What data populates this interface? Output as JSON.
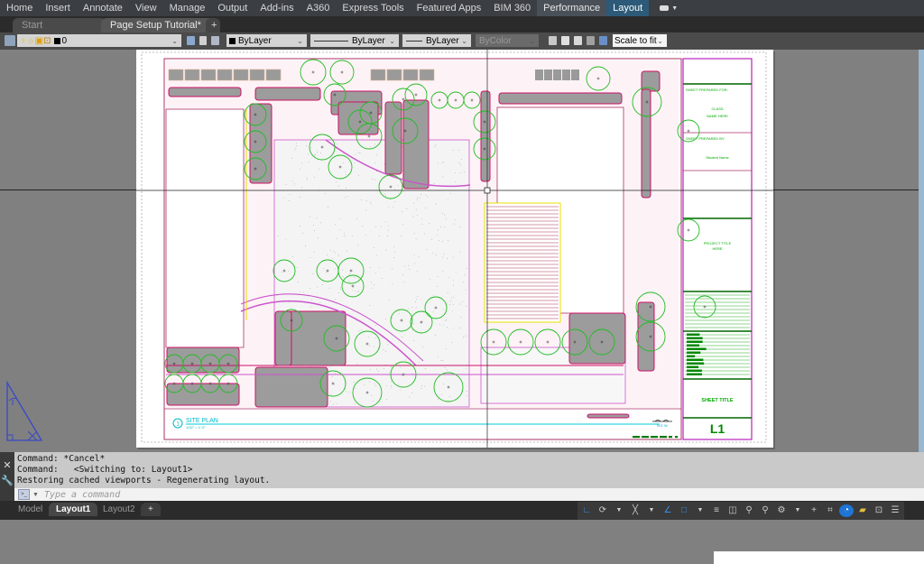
{
  "ribbon": {
    "tabs": [
      "Home",
      "Insert",
      "Annotate",
      "View",
      "Manage",
      "Output",
      "Add-ins",
      "A360",
      "Express Tools",
      "Featured Apps",
      "BIM 360",
      "Performance",
      "Layout"
    ],
    "active_tab": "Layout"
  },
  "doc_tabs": {
    "start": "Start",
    "active": "Page Setup Tutorial*",
    "close": "✕",
    "new": "+"
  },
  "properties": {
    "layer": "0",
    "color": "ByLayer",
    "linetype": "ByLayer",
    "lineweight": "ByLayer",
    "plotstyle": "ByColor",
    "viewport_scale": "Scale to fit"
  },
  "drawing": {
    "view_title": "SITE PLAN",
    "view_number": "1",
    "view_scale": "1/32\" = 1'-0\"",
    "title_block": {
      "prepared_for_label": "SHEET PREPARED FOR:",
      "prepared_for_value_1": "CLASS",
      "prepared_for_value_2": "NAME HERE",
      "prepared_by_label": "SHEET PREPARED BY:",
      "prepared_by_value": "Student Name",
      "project_title_1": "PROJECT TITLE",
      "project_title_2": "HERE",
      "sheet_title": "SHEET TITLE",
      "sheet_number": "L1"
    },
    "colors": {
      "tree": "#22bb22",
      "hardscape": "#cc1166",
      "border": "#aa22aa",
      "paving": "#e8a0b8",
      "structure": "#e8e000",
      "label": "#00b8c8",
      "title_text": "#008800"
    }
  },
  "command": {
    "history": [
      "Command: *Cancel*",
      "Command:   <Switching to: Layout1>",
      "Restoring cached viewports - Regenerating layout."
    ],
    "placeholder": "Type a command"
  },
  "layout_tabs": [
    "Model",
    "Layout1",
    "Layout2"
  ],
  "active_layout": "Layout1",
  "status": {
    "space": "PAPER"
  }
}
